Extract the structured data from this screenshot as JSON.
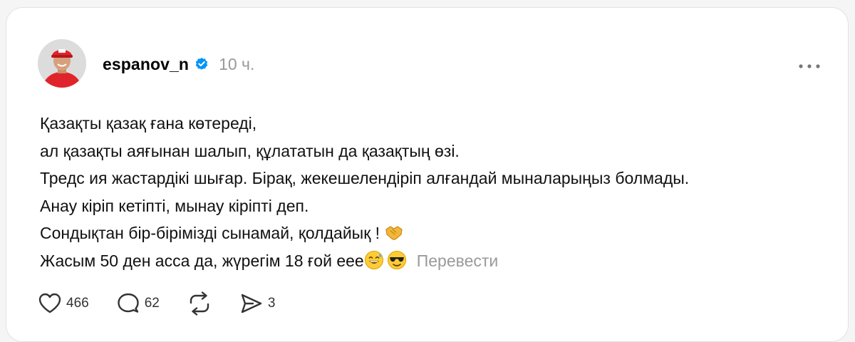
{
  "post": {
    "username": "espanov_n",
    "verified": true,
    "time": "10 ч.",
    "more_icon": "ellipsis-icon",
    "lines": [
      "Қазақты қазақ ғана көтереді,",
      "ал қазақты аяғынан шалып, құлататын да қазақтың өзі.",
      "Тредс ия жастардікі шығар. Бірақ, жекешелендіріп алғандай мыналарыңыз болмады.",
      "Анау кіріп кетіпті, мынау кіріпті деп.",
      "Сондықтан бір-бірімізді сынамай, қолдайық !",
      "Жасым 50 ден асса да, жүрегім 18 ғой еее"
    ],
    "emojis": {
      "line5": "handshake-emoji",
      "line6": [
        "sweat-smile-emoji",
        "sunglasses-emoji"
      ]
    },
    "translate_label": "Перевести"
  },
  "actions": {
    "likes": "466",
    "comments": "62",
    "shares": "3",
    "icons": [
      "heart-icon",
      "comment-icon",
      "repost-icon",
      "share-icon"
    ]
  },
  "colors": {
    "verified_blue": "#0095f6",
    "muted": "#999999"
  }
}
